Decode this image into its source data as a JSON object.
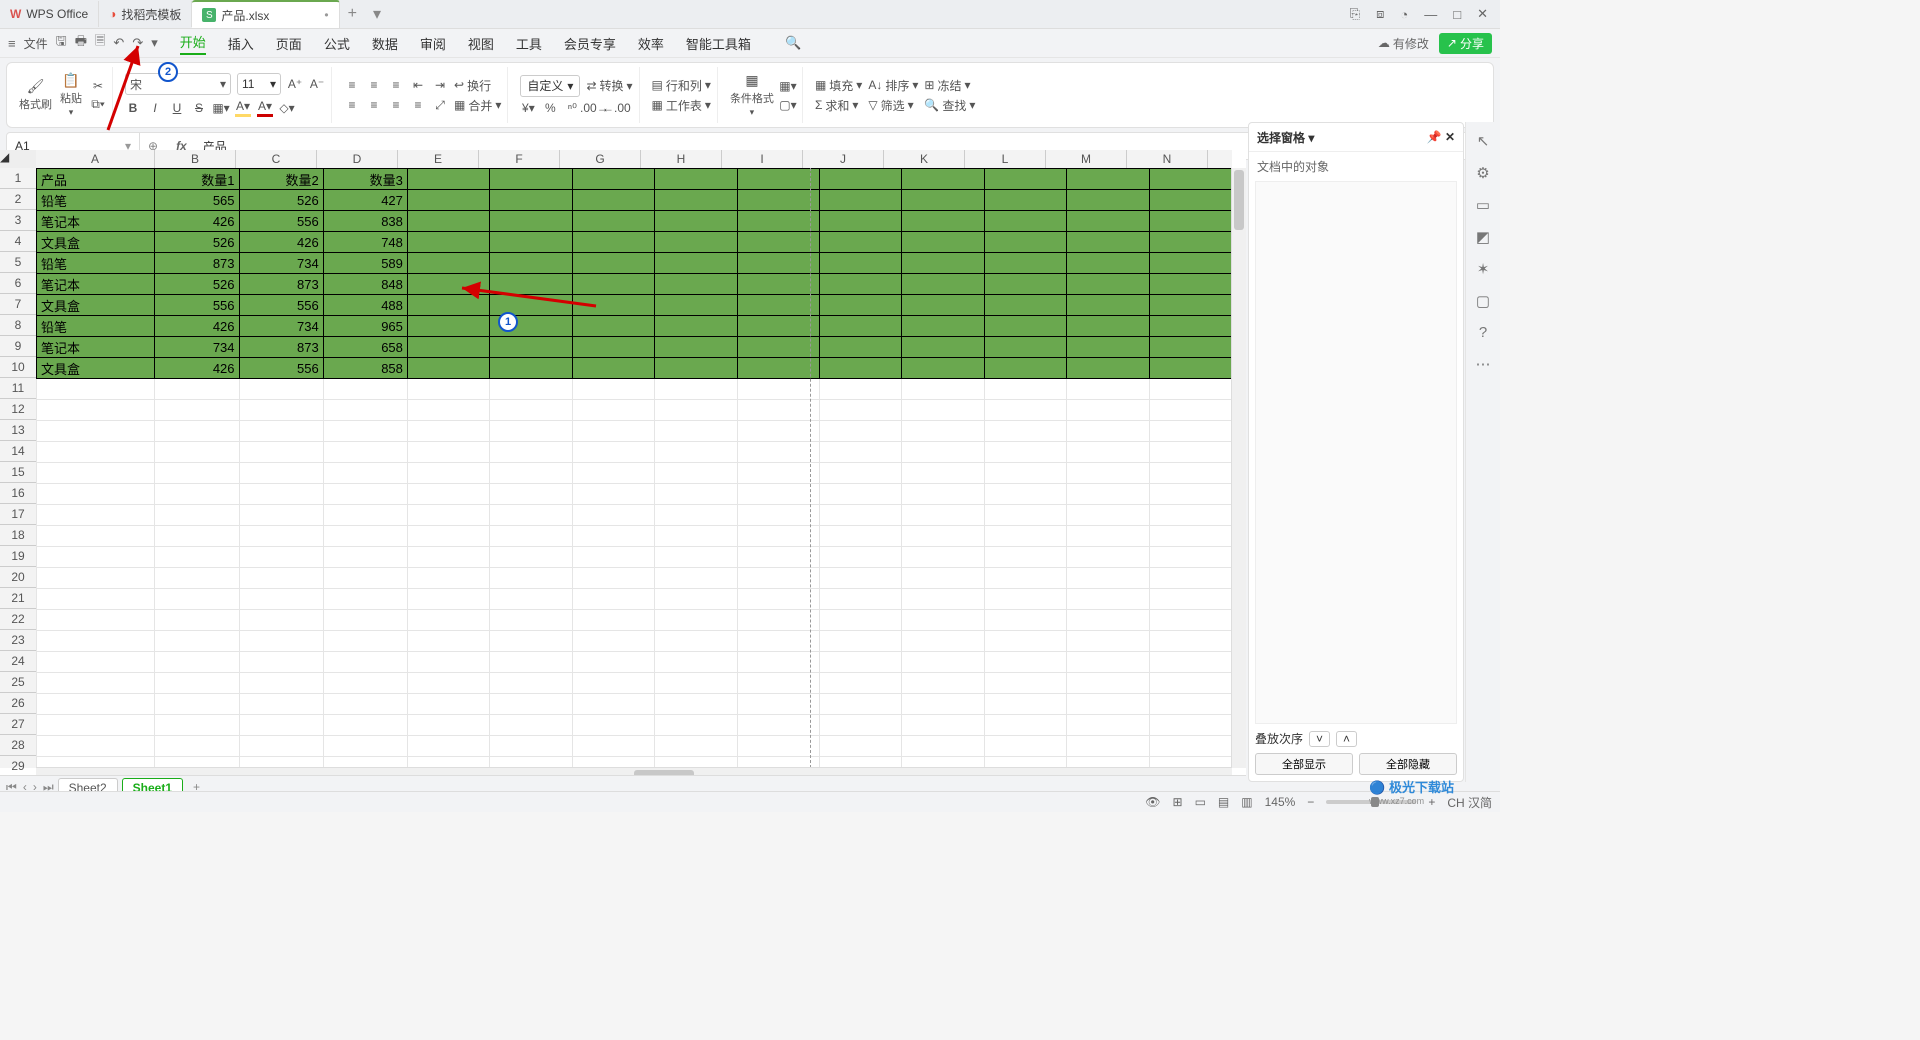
{
  "titlebar": {
    "app_name": "WPS Office",
    "template_tab": "找稻壳模板",
    "doc_tab": "产品.xlsx",
    "doc_badge": "S"
  },
  "win": {
    "book": "⎘",
    "cube": "⧈",
    "avatar": "◔",
    "min": "—",
    "max": "□",
    "close": "✕"
  },
  "menubar": {
    "file": "文件",
    "items": [
      "开始",
      "插入",
      "页面",
      "公式",
      "数据",
      "审阅",
      "视图",
      "工具",
      "会员专享",
      "效率",
      "智能工具箱"
    ],
    "has_changes": "有修改",
    "share": "分享"
  },
  "ribbon": {
    "format_painter": "格式刷",
    "paste": "粘贴",
    "font_name": "宋",
    "font_size": "11",
    "bold": "B",
    "italic": "I",
    "underline": "U",
    "strike": "S",
    "wrap": "换行",
    "merge": "合并",
    "number_format": "自定义",
    "transform": "转换",
    "row_col": "行和列",
    "worksheet": "工作表",
    "cond_fmt": "条件格式",
    "fill": "填充",
    "sort": "排序",
    "freeze": "冻结",
    "sum": "求和",
    "filter": "筛选",
    "find": "查找"
  },
  "fx": {
    "cell": "A1",
    "label": "fx",
    "value": "产品"
  },
  "columns": [
    "A",
    "B",
    "C",
    "D",
    "E",
    "F",
    "G",
    "H",
    "I",
    "J",
    "K",
    "L",
    "M",
    "N"
  ],
  "rowcount": 30,
  "table": {
    "headers": [
      "产品",
      "数量1",
      "数量2",
      "数量3"
    ],
    "rows": [
      [
        "铅笔",
        "565",
        "526",
        "427"
      ],
      [
        "笔记本",
        "426",
        "556",
        "838"
      ],
      [
        "文具盒",
        "526",
        "426",
        "748"
      ],
      [
        "铅笔",
        "873",
        "734",
        "589"
      ],
      [
        "笔记本",
        "526",
        "873",
        "848"
      ],
      [
        "文具盒",
        "556",
        "556",
        "488"
      ],
      [
        "铅笔",
        "426",
        "734",
        "965"
      ],
      [
        "笔记本",
        "734",
        "873",
        "658"
      ],
      [
        "文具盒",
        "426",
        "556",
        "858"
      ]
    ]
  },
  "rpane": {
    "title": "选择窗格",
    "subtitle": "文档中的对象",
    "order": "叠放次序",
    "show_all": "全部显示",
    "hide_all": "全部隐藏"
  },
  "tabs": {
    "sheet2": "Sheet2",
    "sheet1": "Sheet1"
  },
  "status": {
    "zoom": "145%",
    "ime": "CH 汉简"
  },
  "badges": {
    "one": "1",
    "two": "2"
  },
  "watermark": {
    "brand": "极光下载站",
    "url": "www.xz7.com"
  }
}
